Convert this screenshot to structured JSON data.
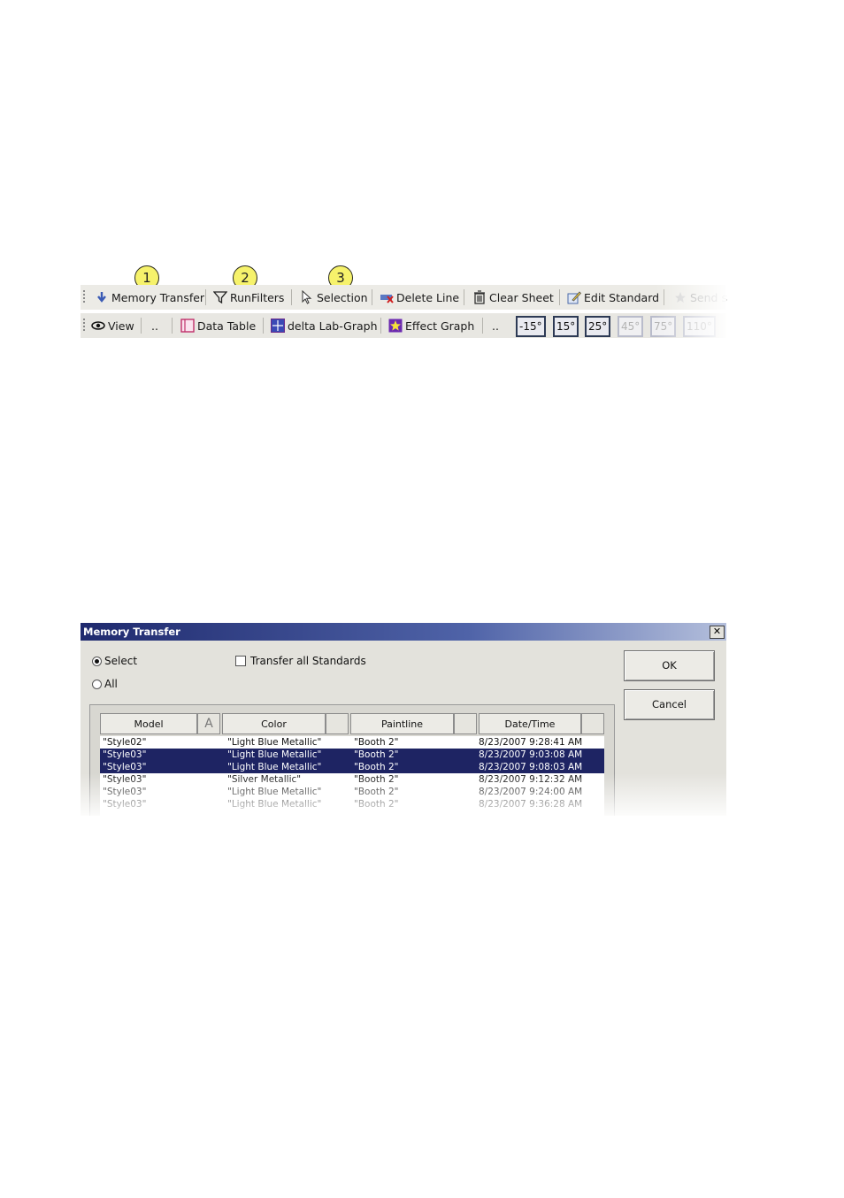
{
  "toolbar": {
    "row1": {
      "memory_transfer": "Memory Transfer",
      "run_filters": "RunFilters",
      "selection": "Selection",
      "delete_line": "Delete Line",
      "clear_sheet": "Clear Sheet",
      "edit_standard": "Edit Standard",
      "send": "Send s"
    },
    "row2": {
      "view": "View",
      "more1": "..",
      "data_table": "Data Table",
      "delta_graph": "delta Lab-Graph",
      "effect_graph": "Effect Graph",
      "more2": "..",
      "angles": [
        "-15°",
        "15°",
        "25°",
        "45°",
        "75°",
        "110°"
      ]
    },
    "callouts": [
      "1",
      "2",
      "3"
    ]
  },
  "dialog": {
    "title": "Memory Transfer",
    "close_glyph": "✕",
    "radio_select": "Select",
    "radio_all": "All",
    "checkbox_transfer_all": "Transfer all Standards",
    "ok": "OK",
    "cancel": "Cancel",
    "columns": [
      "Model",
      "Color",
      "Paintline",
      "Date/Time"
    ],
    "model_sort_glyph": "A",
    "rows": [
      {
        "model": "\"Style02\"",
        "color": "\"Light Blue Metallic\"",
        "paintline": "\"Booth 2\"",
        "datetime": "8/23/2007 9:28:41 AM",
        "selected": false
      },
      {
        "model": "\"Style03\"",
        "color": "\"Light Blue Metallic\"",
        "paintline": "\"Booth 2\"",
        "datetime": "8/23/2007 9:03:08 AM",
        "selected": true
      },
      {
        "model": "\"Style03\"",
        "color": "\"Light Blue Metallic\"",
        "paintline": "\"Booth 2\"",
        "datetime": "8/23/2007 9:08:03 AM",
        "selected": true
      },
      {
        "model": "\"Style03\"",
        "color": "\"Silver Metallic\"",
        "paintline": "\"Booth 2\"",
        "datetime": "8/23/2007 9:12:32 AM",
        "selected": false
      },
      {
        "model": "\"Style03\"",
        "color": "\"Light Blue Metallic\"",
        "paintline": "\"Booth 2\"",
        "datetime": "8/23/2007 9:24:00 AM",
        "selected": false
      },
      {
        "model": "\"Style03\"",
        "color": "\"Light Blue Metallic\"",
        "paintline": "\"Booth 2\"",
        "datetime": "8/23/2007 9:36:28 AM",
        "selected": false
      }
    ]
  },
  "colors": {
    "selection": "#1e2463",
    "callout": "#f6f26b",
    "titlebar": "#1f2a6e"
  }
}
